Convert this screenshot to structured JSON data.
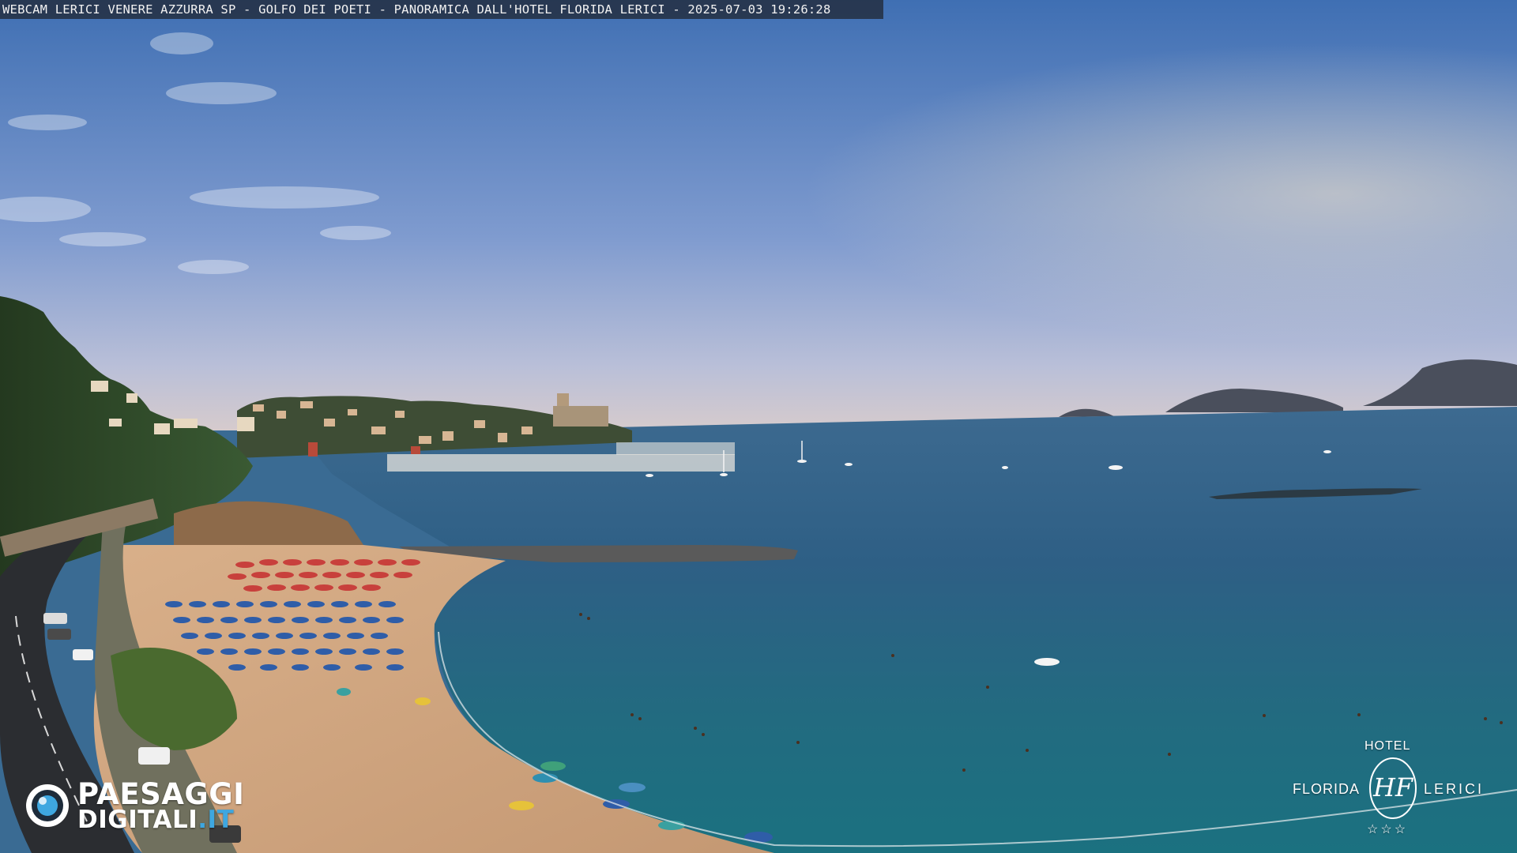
{
  "caption": {
    "text": "WEBCAM LERICI VENERE AZZURRA SP - GOLFO DEI POETI - PANORAMICA DALL'HOTEL FLORIDA LERICI - 2025-07-03 19:26:28"
  },
  "logo_paesaggi": {
    "line1": "PAESAGGI",
    "line2_main": "DIGITALI",
    "line2_tld": ".IT",
    "icon": "camera-lens-icon",
    "accent_color": "#3ea7e0"
  },
  "logo_hotel": {
    "hotel_word": "HOTEL",
    "name_left": "FLORIDA",
    "name_right": "LERICI",
    "monogram": "HF",
    "stars": "☆☆☆"
  },
  "scene_colors": {
    "sky_top": "#4a76b5",
    "sky_horizon": "#c9c9d6",
    "sea_far": "#2f5f86",
    "sea_near": "#1f6a82",
    "sand": "#cfa47e",
    "hill": "#2f4a2a"
  }
}
